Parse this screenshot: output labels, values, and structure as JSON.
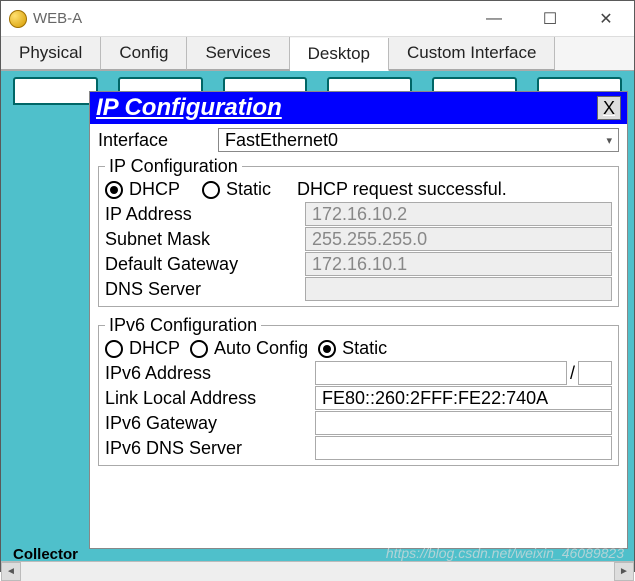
{
  "window": {
    "title": "WEB-A"
  },
  "tabs": {
    "physical": "Physical",
    "config": "Config",
    "services": "Services",
    "desktop": "Desktop",
    "custom": "Custom Interface"
  },
  "ipcfg": {
    "title": "IP Configuration",
    "close": "X",
    "interface_label": "Interface",
    "interface_value": "FastEthernet0",
    "ipv4_legend": "IP Configuration",
    "radio_dhcp": "DHCP",
    "radio_static": "Static",
    "dhcp_status": "DHCP request successful.",
    "ip_address_label": "IP Address",
    "ip_address_value": "172.16.10.2",
    "subnet_label": "Subnet Mask",
    "subnet_value": "255.255.255.0",
    "gateway_label": "Default Gateway",
    "gateway_value": "172.16.10.1",
    "dns_label": "DNS Server",
    "dns_value": "",
    "ipv6_legend": "IPv6 Configuration",
    "ipv6_radio_dhcp": "DHCP",
    "ipv6_radio_auto": "Auto Config",
    "ipv6_radio_static": "Static",
    "ipv6_addr_label": "IPv6 Address",
    "ipv6_addr_value": "",
    "ipv6_slash": "/",
    "ipv6_linklocal_label": "Link Local Address",
    "ipv6_linklocal_value": "FE80::260:2FFF:FE22:740A",
    "ipv6_gateway_label": "IPv6 Gateway",
    "ipv6_gateway_value": "",
    "ipv6_dns_label": "IPv6 DNS Server",
    "ipv6_dns_value": ""
  },
  "desktop_hidden": "Collector",
  "watermark": "https://blog.csdn.net/weixin_46089823"
}
